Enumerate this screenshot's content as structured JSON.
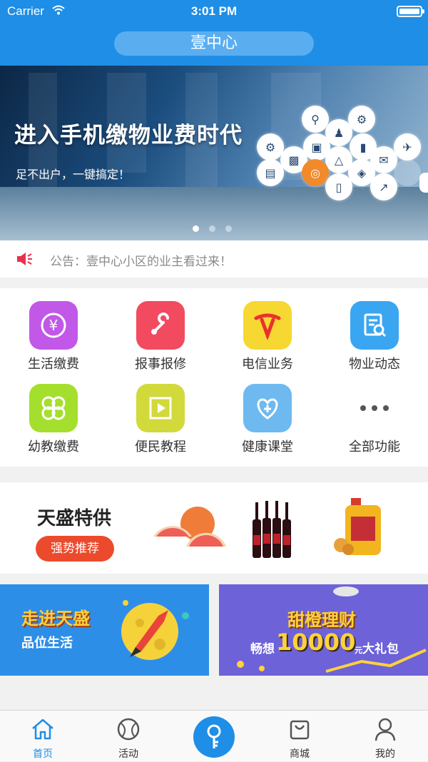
{
  "status_bar": {
    "carrier": "Carrier",
    "time": "3:01 PM"
  },
  "header": {
    "title": "壹中心"
  },
  "banner": {
    "headline": "进入手机缴物业费时代",
    "subline": "足不出户，一键搞定！",
    "slide_count": 3,
    "active_slide": 1
  },
  "notice": {
    "text": "公告：壹中心小区的业主看过来！"
  },
  "services": [
    {
      "label": "生活缴费",
      "icon": "yen-refresh-icon",
      "color": "#c158e8"
    },
    {
      "label": "报事报修",
      "icon": "wrench-icon",
      "color": "#f24a5f"
    },
    {
      "label": "电信业务",
      "icon": "telecom-logo-icon",
      "color": "#f7d732"
    },
    {
      "label": "物业动态",
      "icon": "document-search-icon",
      "color": "#3aa6f2"
    },
    {
      "label": "幼教缴费",
      "icon": "flower-icon",
      "color": "#a5df2e"
    },
    {
      "label": "便民教程",
      "icon": "play-icon",
      "color": "#d2d93a"
    },
    {
      "label": "健康课堂",
      "icon": "heart-plus-icon",
      "color": "#6eb9ef"
    },
    {
      "label": "全部功能",
      "icon": "more-icon",
      "color": "#ffffff"
    }
  ],
  "promo": {
    "title": "天盛特供",
    "button_label": "强势推荐"
  },
  "ad_left": {
    "line1": "走进天盛",
    "line2": "品位生活"
  },
  "ad_right": {
    "line1": "甜橙理财",
    "line2_prefix": "畅想",
    "amount": "10000",
    "unit": "元",
    "line2_suffix": "大礼包"
  },
  "tabs": [
    {
      "label": "首页",
      "icon": "home-icon",
      "active": true
    },
    {
      "label": "活动",
      "icon": "ball-icon",
      "active": false
    },
    {
      "label": "",
      "icon": "key-icon",
      "active": false
    },
    {
      "label": "商城",
      "icon": "shopping-bag-icon",
      "active": false
    },
    {
      "label": "我的",
      "icon": "person-icon",
      "active": false
    }
  ],
  "colors": {
    "brand": "#1f8ee6",
    "promo_button": "#ec4a2c"
  }
}
